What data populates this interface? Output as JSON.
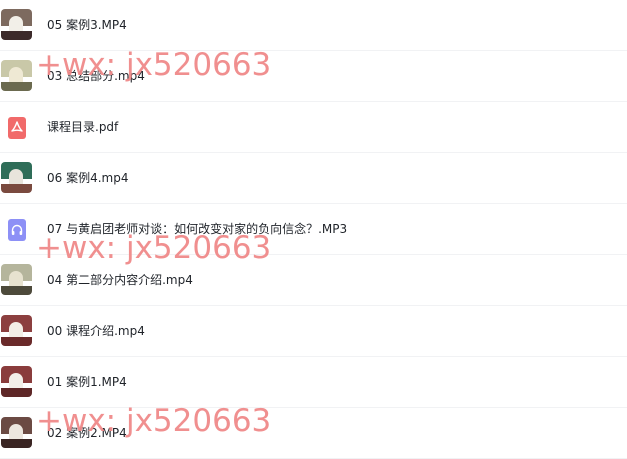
{
  "files": [
    {
      "name": "05 案例3.MP4",
      "icon": "video-thumbnail-icon",
      "thumb": {
        "sky": "#7d6a5f",
        "fig": "#f2efe8",
        "floor": "#3c2a2a"
      }
    },
    {
      "name": "03 总结部分.mp4",
      "icon": "video-thumbnail-icon",
      "thumb": {
        "sky": "#c9c8a8",
        "fig": "#efe9d4",
        "floor": "#6b6a4f"
      }
    },
    {
      "name": "课程目录.pdf",
      "icon": "pdf-icon"
    },
    {
      "name": "06 案例4.mp4",
      "icon": "video-thumbnail-icon",
      "thumb": {
        "sky": "#2f6d58",
        "fig": "#e8e4dc",
        "floor": "#7a4a3f"
      }
    },
    {
      "name": "07 与黄启团老师对谈：如何改变对家的负向信念？.MP3",
      "icon": "audio-icon"
    },
    {
      "name": "04 第二部分内容介绍.mp4",
      "icon": "video-thumbnail-icon",
      "thumb": {
        "sky": "#b5b59c",
        "fig": "#e7e2cf",
        "floor": "#4d4a3b"
      }
    },
    {
      "name": "00 课程介绍.mp4",
      "icon": "video-thumbnail-icon",
      "thumb": {
        "sky": "#8c3f3f",
        "fig": "#f3eee6",
        "floor": "#6a2a2a"
      }
    },
    {
      "name": "01 案例1.MP4",
      "icon": "video-thumbnail-icon",
      "thumb": {
        "sky": "#8a3c3c",
        "fig": "#f3efe9",
        "floor": "#5e2727"
      }
    },
    {
      "name": "02 案例2.MP4",
      "icon": "video-thumbnail-icon",
      "thumb": {
        "sky": "#6b4a43",
        "fig": "#ece6de",
        "floor": "#3a2523"
      }
    }
  ],
  "watermark": "+wx: jx520663",
  "colors": {
    "pdf": "#f16a6a",
    "audio": "#8d90f6",
    "watermark": "#f08a8a"
  }
}
